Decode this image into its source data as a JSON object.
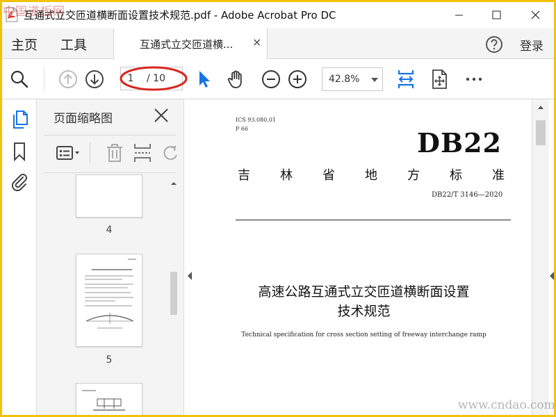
{
  "window": {
    "title": "互通式立交匝道横断面设置技术规范.pdf - Adobe Acrobat Pro DC"
  },
  "menu": {
    "home": "主页",
    "tools": "工具",
    "login": "登录"
  },
  "tab": {
    "label": "互通式立交匝道横...",
    "close": "×"
  },
  "toolbar": {
    "page_current": "1",
    "page_total": "/ 10",
    "zoom": "42.8%"
  },
  "thumbnails": {
    "title": "页面缩略图",
    "pages": [
      {
        "label": "4"
      },
      {
        "label": "5"
      }
    ]
  },
  "document": {
    "ics": "ICS 93.080.01",
    "ccs": "P 66",
    "db_code": "DB22",
    "standard_type_chars": [
      "吉",
      "林",
      "省",
      "地",
      "方",
      "标",
      "准"
    ],
    "standard_number": "DB22/T 3146—2020",
    "title_line1": "高速公路互通式立交匝道横断面设置",
    "title_line2": "技术规范",
    "subtitle_en": "Technical specification for cross section setting of freeway interchange ramp"
  },
  "watermarks": {
    "top": "中国道板网",
    "bottom": "www.cndao.com"
  },
  "colors": {
    "accent_blue": "#1473e6",
    "annotation_red": "#d9241c",
    "frame_yellow": "#f2c20a"
  }
}
